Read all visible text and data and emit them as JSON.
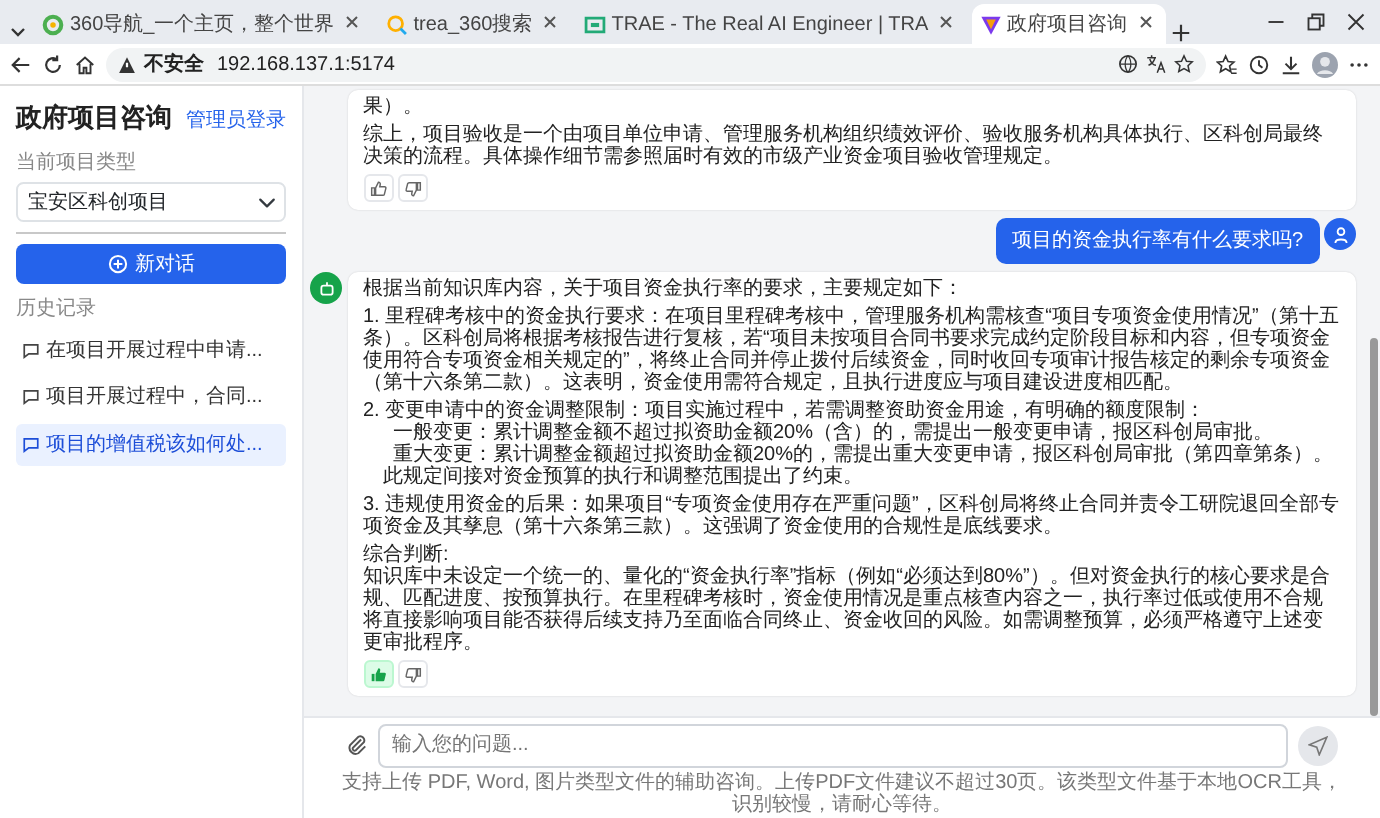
{
  "browser": {
    "tabs": [
      {
        "title": "360导航_一个主页，整个世界",
        "selected": false,
        "kind": "nav"
      },
      {
        "title": "trea_360搜索",
        "selected": false,
        "kind": "search"
      },
      {
        "title": "TRAE - The Real AI Engineer | TRA",
        "selected": false,
        "kind": "trae"
      },
      {
        "title": "政府项目咨询",
        "selected": true,
        "kind": "app"
      }
    ],
    "address": {
      "security": "不安全",
      "url": "192.168.137.1:5174"
    }
  },
  "sidebar": {
    "title": "政府项目咨询",
    "admin_link": "管理员登录",
    "project_type_label": "当前项目类型",
    "project_type_value": "宝安区科创项目",
    "new_chat_button": "新对话",
    "history_label": "历史记录",
    "history": [
      {
        "title": "在项目开展过程中申请...",
        "selected": false
      },
      {
        "title": "项目开展过程中，合同...",
        "selected": false
      },
      {
        "title": "项目的增值税该如何处...",
        "selected": true
      }
    ]
  },
  "messages": [
    {
      "kind": "assistant",
      "liked": false,
      "paragraphs": [
        {
          "lines": [
            {
              "kind": "text",
              "text": "果）。"
            }
          ]
        },
        {
          "lines": [
            {
              "kind": "text",
              "text": "综上，项目验收是一个由项目单位申请、管理服务机构组织绩效评价、验收服务机构具体执行、区科创局最终决策的流程。具体操作细节需参照届时有效的市级产业资金项目验收管理规定。"
            }
          ]
        }
      ]
    },
    {
      "kind": "user",
      "text": "项目的资金执行率有什么要求吗?"
    },
    {
      "kind": "assistant",
      "liked": true,
      "paragraphs": [
        {
          "lines": [
            {
              "kind": "text",
              "text": "根据当前知识库内容，关于项目资金执行率的要求，主要规定如下："
            }
          ]
        },
        {
          "lines": [
            {
              "kind": "text",
              "text": "1. 里程碑考核中的资金执行要求：在项目里程碑考核中，管理服务机构需核查“项目专项资金使用情况”（第十五条）。区科创局将根据考核报告进行复核，若“项目未按项目合同书要求完成约定阶段目标和内容，但专项资金使用符合专项资金相关规定的”，将终止合同并停止拨付后续资金，同时收回专项审计报告核定的剩余专项资金（第十六条第二款）。这表明，资金使用需符合规定，且执行进度应与项目建设进度相匹配。"
            }
          ]
        },
        {
          "lines": [
            {
              "kind": "text",
              "text": "2. 变更申请中的资金调整限制：项目实施过程中，若需调整资助资金用途，有明确的额度限制："
            },
            {
              "kind": "sub",
              "text": "一般变更：累计调整金额不超过拟资助金额20%（含）的，需提出一般变更申请，报区科创局审批。"
            },
            {
              "kind": "sub",
              "text": "重大变更：累计调整金额超过拟资助金额20%的，需提出重大变更申请，报区科创局审批（第四章第条）。"
            },
            {
              "kind": "note",
              "text": "此规定间接对资金预算的执行和调整范围提出了约束。"
            }
          ]
        },
        {
          "lines": [
            {
              "kind": "text",
              "text": "3. 违规使用资金的后果：如果项目“专项资金使用存在严重问题”，区科创局将终止合同并责令工研院退回全部专项资金及其孳息（第十六条第三款）。这强调了资金使用的合规性是底线要求。"
            }
          ]
        },
        {
          "lines": [
            {
              "kind": "text",
              "text": "综合判断:"
            },
            {
              "kind": "text",
              "text": "知识库中未设定一个统一的、量化的“资金执行率”指标（例如“必须达到80%”）。但对资金执行的核心要求是合规、匹配进度、按预算执行。在里程碑考核时，资金使用情况是重点核查内容之一，执行率过低或使用不合规将直接影响项目能否获得后续支持乃至面临合同终止、资金收回的风险。如需调整预算，必须严格遵守上述变更审批程序。"
            }
          ]
        }
      ]
    }
  ],
  "composer": {
    "placeholder": "输入您的问题...",
    "hint": "支持上传 PDF, Word, 图片类型文件的辅助咨询。上传PDF文件建议不超过30页。该类型文件基于本地OCR工具，识别较慢，请耐心等待。"
  }
}
